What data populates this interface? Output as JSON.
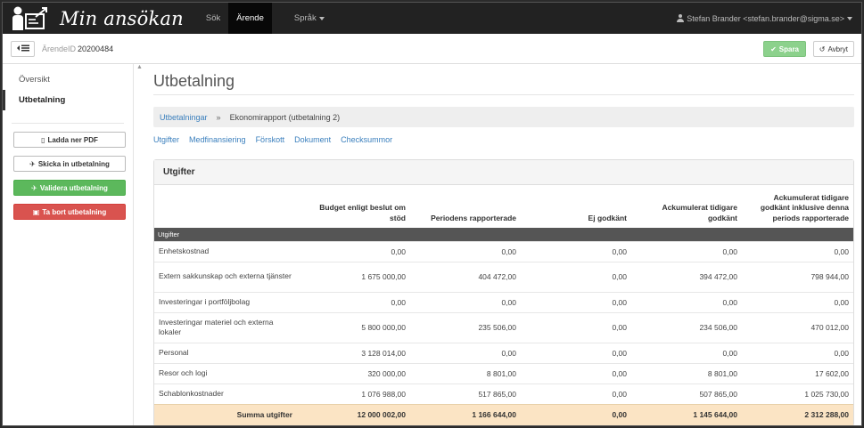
{
  "app": {
    "title": "Min ansökan"
  },
  "nav": {
    "items": [
      {
        "label": "Sök"
      },
      {
        "label": "Ärende"
      },
      {
        "label": "Språk"
      }
    ],
    "user": "Stefan Brander <stefan.brander@sigma.se>"
  },
  "subheader": {
    "case_label": "ÄrendeID",
    "case_id": "20200484",
    "save_label": "Spara",
    "cancel_label": "Avbryt"
  },
  "sidebar": {
    "items": [
      {
        "label": "Översikt"
      },
      {
        "label": "Utbetalning"
      }
    ],
    "buttons": [
      {
        "label": "Ladda ner PDF"
      },
      {
        "label": "Skicka in utbetalning"
      },
      {
        "label": "Validera utbetalning"
      },
      {
        "label": "Ta bort utbetalning"
      }
    ]
  },
  "main": {
    "title": "Utbetalning",
    "breadcrumb": {
      "link": "Utbetalningar",
      "separator": "»",
      "current": "Ekonomirapport (utbetalning 2)"
    },
    "tabs": [
      {
        "label": "Utgifter"
      },
      {
        "label": "Medfinansiering"
      },
      {
        "label": "Förskott"
      },
      {
        "label": "Dokument"
      },
      {
        "label": "Checksummor"
      }
    ],
    "panel": {
      "heading": "Utgifter",
      "columns": [
        "",
        "Budget enligt beslut om stöd",
        "Periodens rapporterade",
        "Ej godkänt",
        "Ackumulerat tidigare godkänt",
        "Ackumulerat tidigare godkänt inklusive denna periods rapporterade"
      ],
      "group": "Utgifter",
      "rows": [
        [
          "Enhetskostnad",
          "0,00",
          "0,00",
          "0,00",
          "0,00",
          "0,00"
        ],
        [
          "Extern sakkunskap och externa tjänster",
          "1 675 000,00",
          "404 472,00",
          "0,00",
          "394 472,00",
          "798 944,00"
        ],
        [
          "Investeringar i portföljbolag",
          "0,00",
          "0,00",
          "0,00",
          "0,00",
          "0,00"
        ],
        [
          "Investeringar materiel och externa lokaler",
          "5 800 000,00",
          "235 506,00",
          "0,00",
          "234 506,00",
          "470 012,00"
        ],
        [
          "Personal",
          "3 128 014,00",
          "0,00",
          "0,00",
          "0,00",
          "0,00"
        ],
        [
          "Resor och logi",
          "320 000,00",
          "8 801,00",
          "0,00",
          "8 801,00",
          "17 602,00"
        ],
        [
          "Schablonkostnader",
          "1 076 988,00",
          "517 865,00",
          "0,00",
          "507 865,00",
          "1 025 730,00"
        ]
      ],
      "sum": [
        "Summa utgifter",
        "12 000 002,00",
        "1 166 644,00",
        "0,00",
        "1 145 644,00",
        "2 312 288,00"
      ]
    }
  }
}
